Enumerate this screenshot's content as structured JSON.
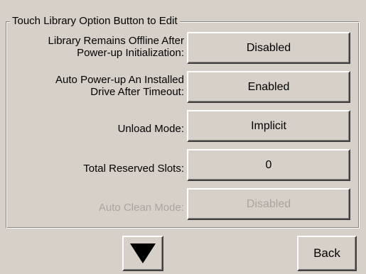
{
  "group": {
    "title": "Touch Library Option Button to Edit"
  },
  "options": [
    {
      "label_line1": "Library Remains Offline After",
      "label_line2": "Power-up Initialization:",
      "value": "Disabled",
      "enabled": true
    },
    {
      "label_line1": "Auto Power-up An Installed",
      "label_line2": "Drive After Timeout:",
      "value": "Enabled",
      "enabled": true
    },
    {
      "label_line1": "Unload Mode:",
      "value": "Implicit",
      "enabled": true
    },
    {
      "label_line1": "Total Reserved Slots:",
      "value": "0",
      "enabled": true
    },
    {
      "label_line1": "Auto Clean Mode:",
      "value": "Disabled",
      "enabled": false
    }
  ],
  "nav": {
    "down_icon": "triangle-down-icon",
    "back_label": "Back"
  }
}
